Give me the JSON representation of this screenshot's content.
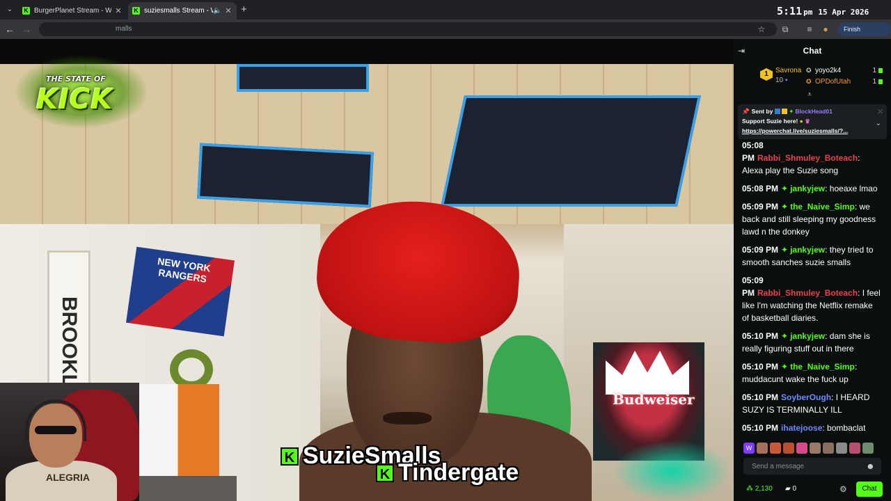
{
  "browser": {
    "tabs": [
      {
        "label": "BurgerPlanet Stream - Watch Li",
        "active": false
      },
      {
        "label": "suziesmalls Stream - Watch",
        "active": true
      }
    ],
    "url_fragment": "malls",
    "finish_update_label": "Finish update"
  },
  "clock": {
    "time": "5:11",
    "ampm": "pm",
    "date": "15 Apr 2026"
  },
  "overlay": {
    "logo_top": "THE STATE OF",
    "logo_main": "KICK",
    "names": [
      "SuzieSmalls",
      "Tindergate"
    ],
    "webcam_shirt_text": "ALEGRIA"
  },
  "scene_signs": {
    "rangers": "NEW YORK RANGERS",
    "brooklyn": "BROOKLYN",
    "budweiser": "Budweiser"
  },
  "chat": {
    "title": "Chat",
    "leaderboard": {
      "first": {
        "rank": "1",
        "name": "Savrona",
        "count": "10"
      },
      "others": [
        {
          "name": "yoyo2k4",
          "count": "1"
        },
        {
          "name": "OPDofUtah",
          "count": "1"
        }
      ]
    },
    "pinned": {
      "sent_by_label": "Sent by",
      "user": "BlockHead01",
      "message": "Support Suzie here!",
      "link": "https://powerchat.live/suziesmalls/?..."
    },
    "messages": [
      {
        "time": "05:08 PM",
        "user": "Rabbi_Shmuley_Boteach",
        "color": "#e8434f",
        "badge": false,
        "text": ": Alexa play the Suzie song"
      },
      {
        "time": "05:08 PM",
        "user": "jankyjew",
        "color": "#53fc18",
        "badge": true,
        "text": ": hoeaxe lmao"
      },
      {
        "time": "05:09 PM",
        "user": "the_Naive_Simp",
        "color": "#53fc18",
        "badge": true,
        "text": ": we back and still sleeping my goodness lawd n the donkey"
      },
      {
        "time": "05:09 PM",
        "user": "jankyjew",
        "color": "#53fc18",
        "badge": true,
        "text": ": they tried to smooth sanches suzie smalls"
      },
      {
        "time": "05:09 PM",
        "user": "Rabbi_Shmuley_Boteach",
        "color": "#e8434f",
        "badge": false,
        "text": ": I feel like I'm watching the Netflix remake of basketball diaries."
      },
      {
        "time": "05:10 PM",
        "user": "jankyjew",
        "color": "#53fc18",
        "badge": true,
        "text": ": dam she is really figuring stuff out in there"
      },
      {
        "time": "05:10 PM",
        "user": "the_Naive_Simp",
        "color": "#53fc18",
        "badge": true,
        "text": ": muddacunt wake the fuck up"
      },
      {
        "time": "05:10 PM",
        "user": "SoyberOugh",
        "color": "#6a8cff",
        "badge": false,
        "text": ": I HEARD SUZY IS TERMINALLY ILL"
      },
      {
        "time": "05:10 PM",
        "user": "ihatejoose",
        "color": "#6a8cff",
        "badge": false,
        "text": ": bombaclat suzie wake ya bloodclat ass up !"
      }
    ],
    "send_placeholder": "Send a message",
    "footer": {
      "points": "2,130",
      "zero": "0",
      "chat_button": "Chat"
    }
  },
  "colors": {
    "kick_green": "#53fc18",
    "chat_bg": "#0b0e0f",
    "pin_bg": "#1b1f22"
  }
}
